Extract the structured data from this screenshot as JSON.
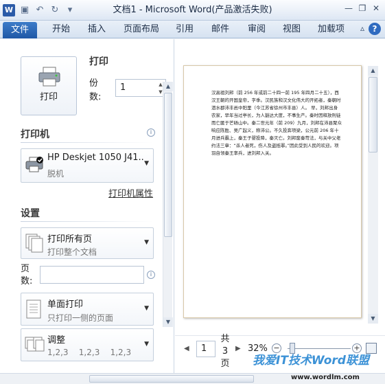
{
  "window": {
    "title": "文档1 - Microsoft Word(产品激活失败)",
    "logo": "W"
  },
  "ribbon": {
    "tabs": [
      "文件",
      "开始",
      "插入",
      "页面布局",
      "引用",
      "邮件",
      "审阅",
      "视图",
      "加载项"
    ]
  },
  "print": {
    "button_label": "打印",
    "section_title": "打印",
    "copies_label": "份数:",
    "copies_value": "1"
  },
  "printer": {
    "section_title": "打印机",
    "name": "HP Deskjet 1050 J41...",
    "status": "脱机",
    "properties_link": "打印机属性"
  },
  "settings": {
    "section_title": "设置",
    "range_main": "打印所有页",
    "range_sub": "打印整个文档",
    "pages_label": "页数:",
    "sides_main": "单面打印",
    "sides_sub": "只打印一侧的页面",
    "collate_main": "调整",
    "collate_sub": "1,2,3    1,2,3    1,2,3"
  },
  "preview": {
    "page_text": "汉高祖刘邦（前 256 年或前二十四一前 195 年四月二十五），西汉王朝的开国皇帝，字季。汉民族和汉文化伟大的开拓者，秦朝时泗水郡沛丰邑中阳里（今江苏省徐州市丰县）人。 早，刘邦出身农家，早年当过亭长，为人豁达大度，不事生产。秦时因释放刑徒而亡匿于芒砀山中。秦二世元年（前 209）九月，刘邦在沛县聚众响应陈胜、吴广起义，称沛公。不久投奔项梁，公元前 206 年十月进兵霸上，秦王子婴投降，秦灭亡。刘邦废秦苛法，与关中父老约法三章：“杀人者死，伤人及盗抵罪。”因此受到人民的欢迎。项羽自领秦王率兵，进刘邦入关。"
  },
  "navigation": {
    "current_page": "1",
    "total_label": "共3页",
    "zoom_label": "32%"
  },
  "watermark": {
    "text": "我爱IT技术Word联盟",
    "url": "www.wordlm.com"
  }
}
